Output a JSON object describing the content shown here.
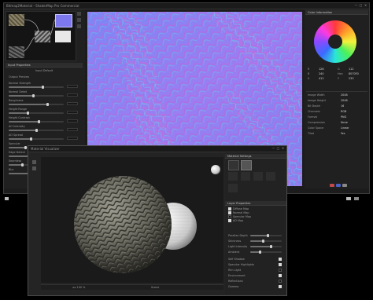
{
  "main_window": {
    "title": "Bitmap2Material - ShaderMap Pro Commercial",
    "controls": [
      "—",
      "□",
      "✕"
    ]
  },
  "left_panel": {
    "node_header": "Input Properties",
    "sections": [
      {
        "label": "Input Default"
      },
      {
        "label": "Output Preview"
      }
    ],
    "params": [
      {
        "label": "Normal Strength",
        "value": "",
        "level": 0.62
      },
      {
        "label": "Normal Detail",
        "value": "",
        "level": 0.45
      },
      {
        "label": "Roughness",
        "value": "",
        "level": 0.7
      },
      {
        "label": "Height Range",
        "value": "",
        "level": 0.35
      },
      {
        "label": "Height Contrast",
        "value": "",
        "level": 0.55
      },
      {
        "label": "AO Intensity",
        "value": "",
        "level": 0.5
      },
      {
        "label": "AO Spread",
        "value": "",
        "level": 0.4
      },
      {
        "label": "Specular",
        "value": "",
        "level": 0.3
      },
      {
        "label": "Edge Detect",
        "value": "",
        "level": 0.6
      },
      {
        "label": "Seamless",
        "value": "",
        "level": 0.25
      },
      {
        "label": "Blur",
        "value": "",
        "level": 0.45
      }
    ]
  },
  "right_panel": {
    "header": "Color Information",
    "info_rows": [
      {
        "k": "R",
        "v": "128"
      },
      {
        "k": "G",
        "v": "112"
      },
      {
        "k": "B",
        "v": "240"
      },
      {
        "k": "Hex",
        "v": "8070F0"
      },
      {
        "k": "X",
        "v": "412"
      },
      {
        "k": "Y",
        "v": "233"
      }
    ],
    "props": [
      {
        "k": "Image Width",
        "v": "2048"
      },
      {
        "k": "Image Height",
        "v": "2048"
      },
      {
        "k": "Bit Depth",
        "v": "16"
      },
      {
        "k": "Channels",
        "v": "RGB"
      },
      {
        "k": "Format",
        "v": "PNG"
      },
      {
        "k": "Compression",
        "v": "None"
      },
      {
        "k": "Color Space",
        "v": "Linear"
      },
      {
        "k": "Tiled",
        "v": "Yes"
      }
    ]
  },
  "viewer_window": {
    "title": "Material Visualizer",
    "controls": [
      "—",
      "□",
      "✕"
    ],
    "bottom_bar_left": "◂ ▸   100 %",
    "bottom_bar_right": "Scene"
  },
  "material_panel": {
    "header": "Material Settings",
    "layer_header": "Layer Properties",
    "rows": [
      {
        "label": "Diffuse Map",
        "checked": true
      },
      {
        "label": "Normal Map",
        "checked": true
      },
      {
        "label": "Specular Map",
        "checked": false
      },
      {
        "label": "AO Map",
        "checked": true
      }
    ],
    "sliders": [
      {
        "label": "Parallax Depth",
        "level": 0.55
      },
      {
        "label": "Shininess",
        "level": 0.4
      },
      {
        "label": "Light Intensity",
        "level": 0.65
      },
      {
        "label": "Ambient",
        "level": 0.3
      }
    ],
    "options": [
      {
        "label": "Self Shadow",
        "checked": true
      },
      {
        "label": "Specular Highlights",
        "checked": true
      },
      {
        "label": "Rim Light",
        "checked": false
      },
      {
        "label": "Environment",
        "checked": true
      },
      {
        "label": "Reflections",
        "checked": false
      },
      {
        "label": "Gamma",
        "checked": true
      }
    ]
  },
  "colors": {
    "normal_base": "#8a7cf0",
    "accent_blue": "#7080ff"
  }
}
